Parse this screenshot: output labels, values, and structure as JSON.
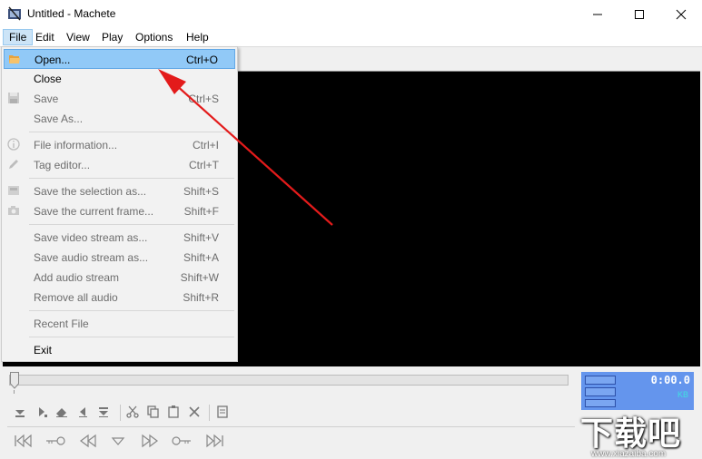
{
  "window": {
    "title": "Untitled - Machete"
  },
  "menubar": [
    "File",
    "Edit",
    "View",
    "Play",
    "Options",
    "Help"
  ],
  "file_menu": [
    {
      "label": "Open...",
      "shortcut": "Ctrl+O",
      "state": "highlighted",
      "icon": "folder-open-icon"
    },
    {
      "label": "Close",
      "shortcut": "",
      "state": "enabled",
      "icon": ""
    },
    {
      "label": "Save",
      "shortcut": "Ctrl+S",
      "state": "disabled",
      "icon": "save-icon"
    },
    {
      "label": "Save As...",
      "shortcut": "",
      "state": "disabled",
      "icon": ""
    },
    {
      "label": "File information...",
      "shortcut": "Ctrl+I",
      "state": "disabled",
      "icon": "info-icon"
    },
    {
      "label": "Tag editor...",
      "shortcut": "Ctrl+T",
      "state": "disabled",
      "icon": "pencil-icon"
    },
    {
      "label": "Save the selection as...",
      "shortcut": "Shift+S",
      "state": "disabled",
      "icon": "save-selection-icon"
    },
    {
      "label": "Save the current frame...",
      "shortcut": "Shift+F",
      "state": "disabled",
      "icon": "camera-icon"
    },
    {
      "label": "Save video stream as...",
      "shortcut": "Shift+V",
      "state": "disabled",
      "icon": ""
    },
    {
      "label": "Save audio stream as...",
      "shortcut": "Shift+A",
      "state": "disabled",
      "icon": ""
    },
    {
      "label": "Add audio stream",
      "shortcut": "Shift+W",
      "state": "disabled",
      "icon": ""
    },
    {
      "label": "Remove all audio",
      "shortcut": "Shift+R",
      "state": "disabled",
      "icon": ""
    },
    {
      "label": "Recent File",
      "shortcut": "",
      "state": "disabled",
      "icon": ""
    },
    {
      "label": "Exit",
      "shortcut": "",
      "state": "enabled",
      "icon": ""
    }
  ],
  "info_panel": {
    "time": "0:00.0",
    "size_unit": "KB"
  },
  "watermark": {
    "text": "下载吧",
    "url": "www.xiazaiba.com"
  },
  "colors": {
    "menu_highlight": "#91c9f7",
    "arrow": "#e31b1b",
    "info_panel": "#6495ed"
  }
}
